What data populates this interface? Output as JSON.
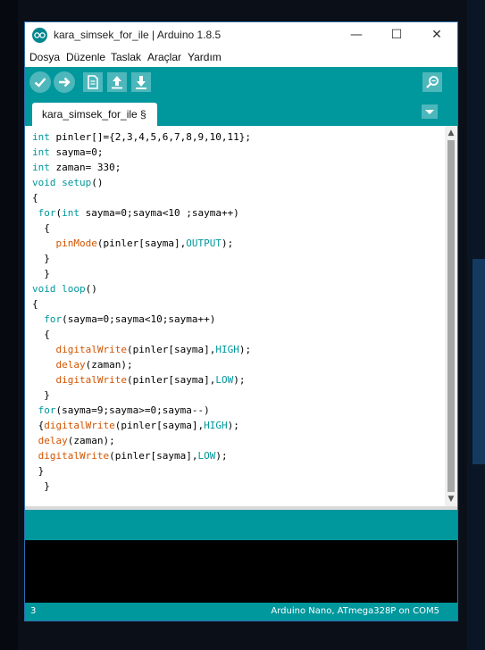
{
  "window": {
    "title": "kara_simsek_for_ile | Arduino 1.8.5",
    "controls": {
      "minimize": "—",
      "maximize": "☐",
      "close": "✕"
    }
  },
  "menu": [
    "Dosya",
    "Düzenle",
    "Taslak",
    "Araçlar",
    "Yardım"
  ],
  "toolbar": {
    "buttons": [
      "verify-icon",
      "upload-icon",
      "new-sketch-icon",
      "open-sketch-icon",
      "save-sketch-icon"
    ],
    "serial_monitor": "serial-monitor-icon"
  },
  "tab": {
    "label": "kara_simsek_for_ile §"
  },
  "code_lines": [
    "int pinler[]={2,3,4,5,6,7,8,9,10,11};",
    "int sayma=0;",
    "int zaman= 330;",
    "void setup()",
    "{",
    " for(int sayma=0;sayma<10 ;sayma++)",
    "  {",
    "    pinMode(pinler[sayma],OUTPUT);",
    "  }",
    "  }",
    "void loop()",
    "{",
    "  for(sayma=0;sayma<10;sayma++)",
    "  {",
    "    digitalWrite(pinler[sayma],HIGH);",
    "    delay(zaman);",
    "    digitalWrite(pinler[sayma],LOW);",
    "  }",
    " for(sayma=9;sayma>=0;sayma--)",
    " {digitalWrite(pinler[sayma],HIGH);",
    " delay(zaman);",
    " digitalWrite(pinler[sayma],LOW);",
    " }",
    "  }"
  ],
  "status": {
    "line": "3",
    "board": "Arduino Nano, ATmega328P on COM5"
  },
  "colors": {
    "teal": "#00979d",
    "button": "#4db7bb",
    "keyword": "#00979c",
    "function": "#d35400"
  }
}
